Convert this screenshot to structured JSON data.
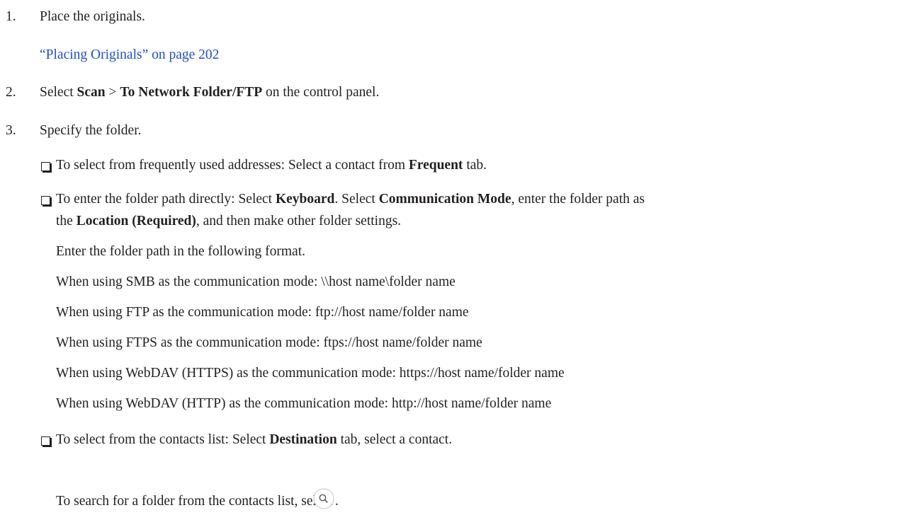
{
  "steps": [
    {
      "number": "1.",
      "text": "Place the originals.",
      "link": "“Placing Originals” on page 202"
    },
    {
      "number": "2.",
      "pre": "Select ",
      "bold1": "Scan",
      "mid": " > ",
      "bold2": "To Network Folder/FTP",
      "post": " on the control panel."
    },
    {
      "number": "3.",
      "text": "Specify the folder."
    }
  ],
  "options": {
    "frequent": {
      "pre": "To select from frequently used addresses: Select a contact from ",
      "bold": "Frequent",
      "post": " tab."
    },
    "keyboard": {
      "pre": "To enter the folder path directly: Select ",
      "bold1": "Keyboard",
      "mid": ". Select ",
      "bold2": "Communication Mode",
      "post": ", enter the folder path as",
      "line2_pre": "the ",
      "line2_bold": "Location (Required)",
      "line2_post": ", and then make other folder settings."
    },
    "format_intro": "Enter the folder path in the following format.",
    "formats": [
      "When using SMB as the communication mode: \\\\host name\\folder name",
      "When using FTP as the communication mode: ftp://host name/folder name",
      "When using FTPS as the communication mode: ftps://host name/folder name",
      "When using WebDAV (HTTPS) as the communication mode: https://host name/folder name",
      "When using WebDAV (HTTP) as the communication mode: http://host name/folder name"
    ],
    "destination": {
      "pre": "To select from the contacts list: Select ",
      "bold": "Destination",
      "post": " tab, select a contact."
    },
    "search": {
      "pre": "To search for a folder from the contacts list, select ",
      "post": "."
    }
  },
  "icons": {
    "checkbox": "checkbox-icon",
    "search": "search-icon"
  }
}
